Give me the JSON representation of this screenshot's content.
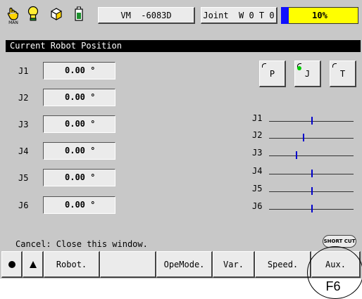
{
  "toolbar": {
    "man_label": "MAN",
    "program_label": "VM  -6083D",
    "coord_label": "Joint  W 0 T 0",
    "speed_value": "10%"
  },
  "panel": {
    "title": "Current Robot Position",
    "joints": [
      {
        "label": "J1",
        "value": "0.00 °"
      },
      {
        "label": "J2",
        "value": "0.00 °"
      },
      {
        "label": "J3",
        "value": "0.00 °"
      },
      {
        "label": "J4",
        "value": "0.00 °"
      },
      {
        "label": "J5",
        "value": "0.00 °"
      },
      {
        "label": "J6",
        "value": "0.00 °"
      }
    ],
    "mode_buttons": [
      "P",
      "J",
      "T"
    ],
    "bars": [
      {
        "label": "J1",
        "position": 0.5
      },
      {
        "label": "J2",
        "position": 0.4
      },
      {
        "label": "J3",
        "position": 0.32
      },
      {
        "label": "J4",
        "position": 0.5
      },
      {
        "label": "J5",
        "position": 0.5
      },
      {
        "label": "J6",
        "position": 0.5
      }
    ]
  },
  "status": {
    "message": "Cancel: Close this window.",
    "shortcut_label": "SHORT CUT"
  },
  "fkeys": {
    "f1": "Robot.",
    "f2": "",
    "f3": "OpeMode.",
    "f4": "Var.",
    "f5": "Speed.",
    "f6": "Aux."
  },
  "annotation": "F6",
  "colors": {
    "panel_bg": "#c8c8c8",
    "speed_bg": "#ffff00",
    "speed_bar": "#1010ff",
    "bar_marker": "#0000cc",
    "led": "#00cc00"
  }
}
